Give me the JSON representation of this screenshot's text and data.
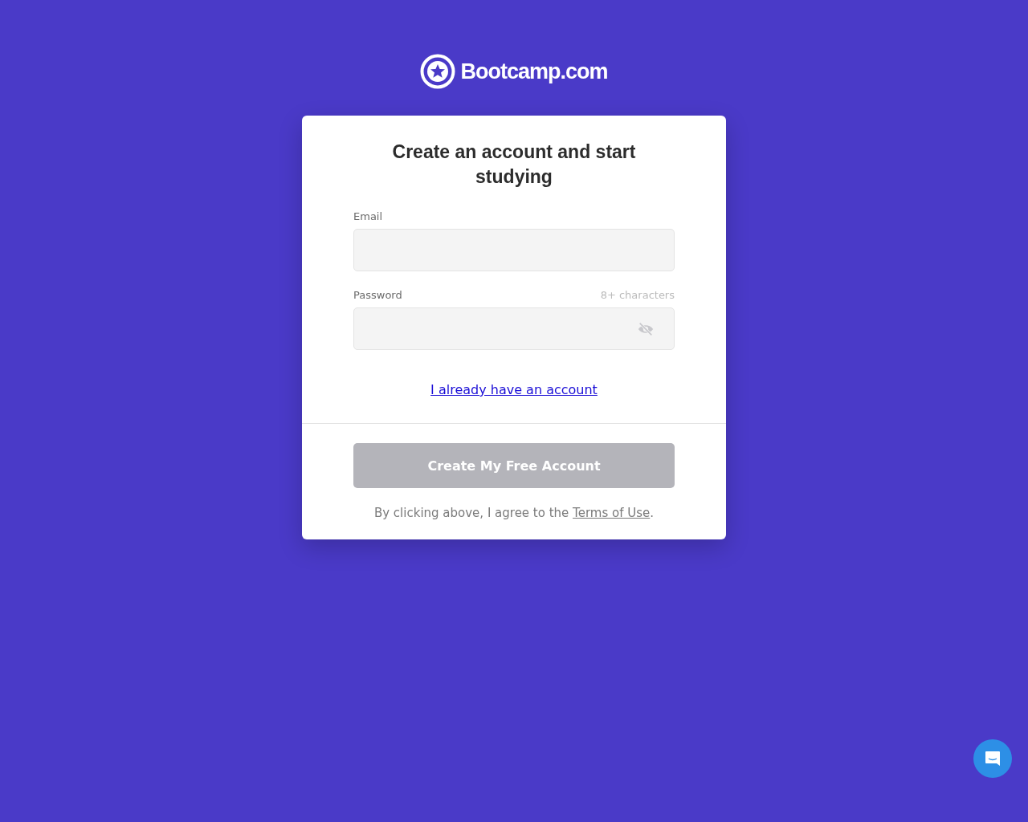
{
  "logo": {
    "text": "Bootcamp.com"
  },
  "card": {
    "title": "Create an account and start studying",
    "fields": [
      {
        "label": "Email",
        "kind": "email"
      },
      {
        "label": "Password",
        "hint": "8+ characters",
        "kind": "password"
      }
    ],
    "login_link": "I already have an account",
    "submit": {
      "label": "Create My Free Account",
      "disabled": true
    },
    "terms": {
      "before": "By clicking above, I agree to the ",
      "link": "Terms of Use",
      "after": "."
    }
  }
}
